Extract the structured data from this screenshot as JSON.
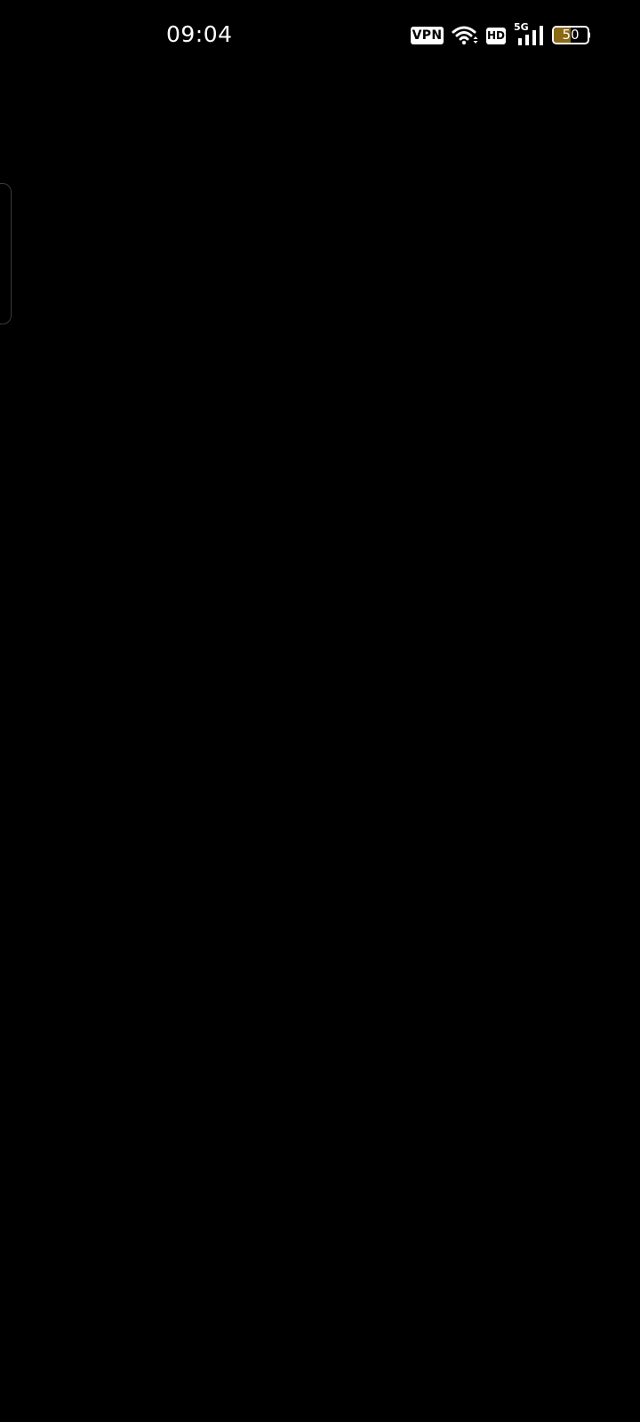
{
  "status_bar": {
    "time": "09:04",
    "vpn_label": "VPN",
    "hd_label": "HD",
    "network_type": "5G",
    "battery_level": "50",
    "battery_fraction": 0.5,
    "battery_fill_color": "#8a6a14",
    "icons": [
      "wifi-icon",
      "signal-icon",
      "battery-icon"
    ]
  },
  "screen": {
    "background_color": "#000000"
  }
}
